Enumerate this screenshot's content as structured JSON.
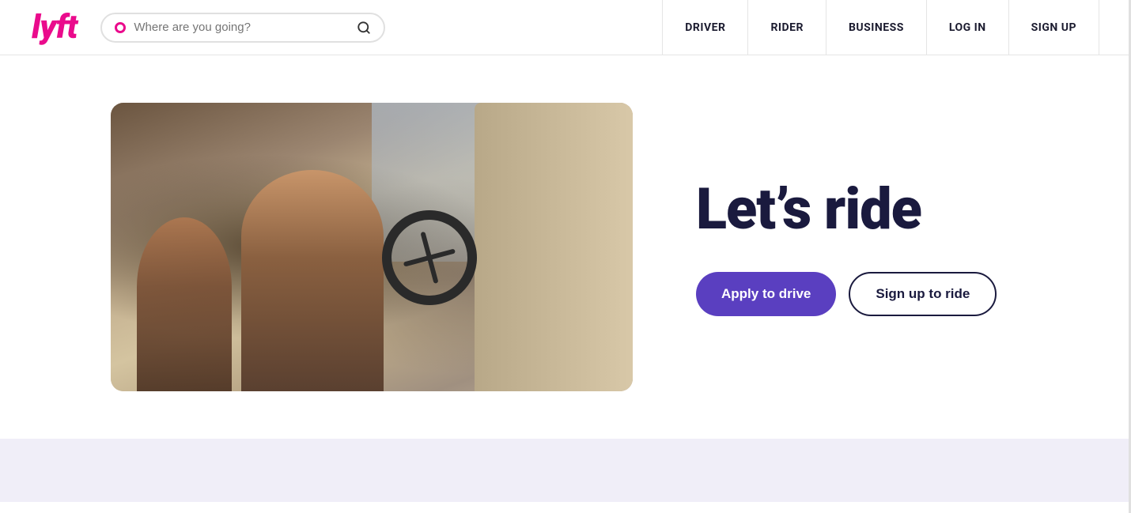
{
  "header": {
    "logo": "lyft",
    "search": {
      "placeholder": "Where are you going?"
    },
    "nav": [
      {
        "id": "driver",
        "label": "DRIVER"
      },
      {
        "id": "rider",
        "label": "RIDER"
      },
      {
        "id": "business",
        "label": "BUSINESS"
      },
      {
        "id": "login",
        "label": "LOG IN"
      },
      {
        "id": "signup",
        "label": "SIGN UP"
      }
    ]
  },
  "hero": {
    "heading": "Let’s ride",
    "apply_button": "Apply to drive",
    "signup_button": "Sign up to ride"
  },
  "colors": {
    "lyft_pink": "#ea0b8c",
    "nav_dark": "#1a1a2e",
    "hero_dark": "#1a1a3e",
    "btn_purple": "#5a3fc0"
  }
}
